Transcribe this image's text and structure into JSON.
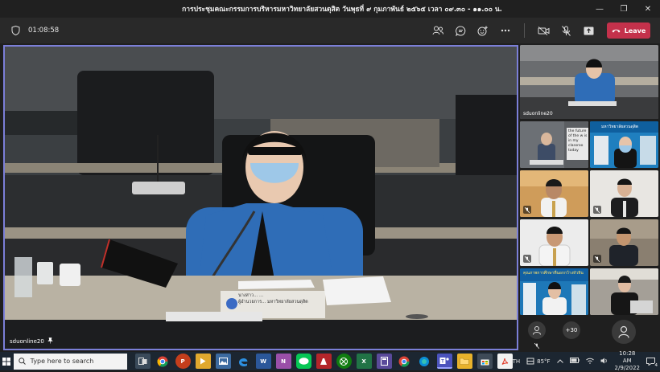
{
  "window": {
    "title": "การประชุมคณะกรรมการบริหารมหาวิทยาลัยสวนดุสิต วันพุธที่ ๙ กุมภาพันธ์ ๒๕๖๕ เวลา ๐๙.๓๐ - ๑๑.๐๐ น."
  },
  "toolbar": {
    "timer": "01:08:58",
    "leave_label": "Leave"
  },
  "stage": {
    "participant_name": "sduonline20",
    "nameplate_line1": "นางสาว... ...",
    "nameplate_line2": "ผู้อำนวยการ... มหาวิทยาลัยสวนดุสิต"
  },
  "panel": {
    "tiles": [
      {
        "label": "sduonline20"
      },
      {
        "label": "the future of the w is in my classroo today"
      },
      {
        "label": "มหาวิทยาลัยสวนดุสิต"
      },
      {
        "label": "คุณภาพการศึกษาที่นอกกว้างหัวหิน"
      }
    ],
    "more_count": "+30"
  },
  "taskbar": {
    "search_placeholder": "Type here to search",
    "lang": "TH",
    "weather": "85°F",
    "time": "10:28 AM",
    "date": "2/9/2022",
    "notif_count": "4"
  },
  "colors": {
    "leave": "#c4314b",
    "stage_border": "#7b7fd8",
    "suit_blue": "#2f6db7"
  }
}
